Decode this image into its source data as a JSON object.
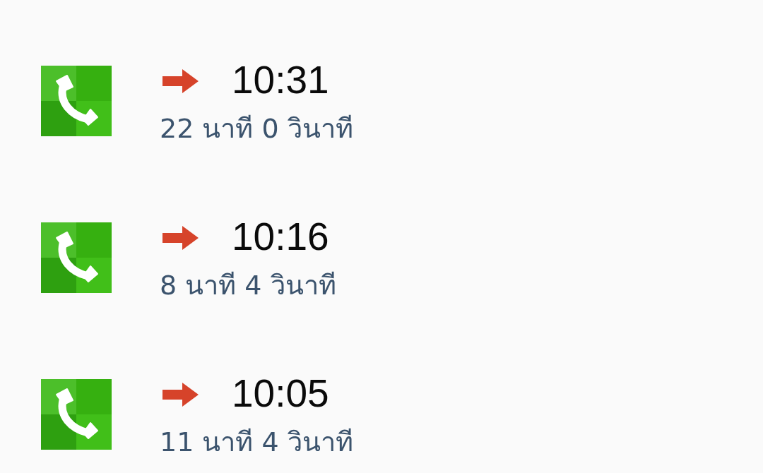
{
  "calls": [
    {
      "kind": "outgoing",
      "time": "10:31",
      "duration": "22 นาที 0 วินาที"
    },
    {
      "kind": "outgoing",
      "time": "10:16",
      "duration": "8 นาที 4 วินาที"
    },
    {
      "kind": "outgoing",
      "time": "10:05",
      "duration": "11 นาที 4 วินาที"
    }
  ]
}
